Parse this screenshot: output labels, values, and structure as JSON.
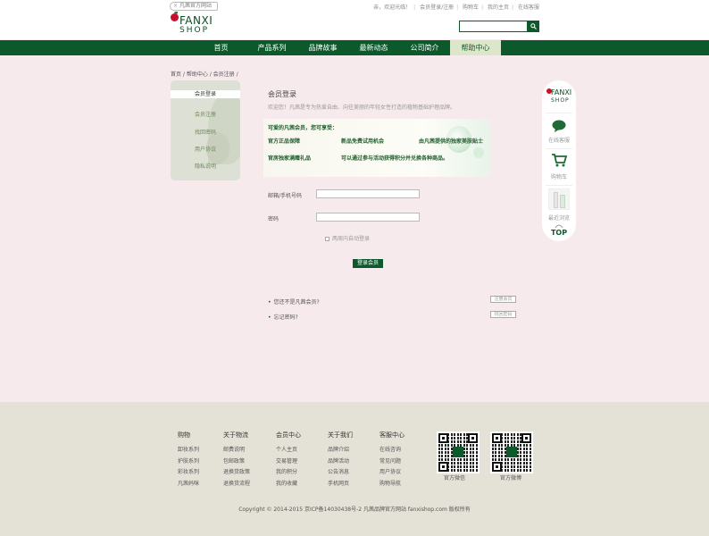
{
  "topbar": {
    "official_label": "凡茜官方网站",
    "links": [
      "亲，欢迎光临！",
      "会员登录/注册",
      "购物车",
      "我的主页",
      "在线客服"
    ]
  },
  "logo": {
    "line1": "FANXI",
    "line2": "SHOP"
  },
  "search": {
    "placeholder": ""
  },
  "nav": {
    "items": [
      "首页",
      "产品系列",
      "品牌故事",
      "最新动态",
      "公司简介",
      "帮助中心"
    ],
    "active_index": 5
  },
  "breadcrumb": "首页 / 帮助中心 / 会员注册 /",
  "sidebar": {
    "items": [
      "会员登录",
      "会员注册",
      "找回密码",
      "用户协议",
      "隐私说明"
    ],
    "active_index": 0
  },
  "login": {
    "title": "会员登录",
    "desc": "欢迎您！凡茜是专为热爱自由、向往美丽的年轻女性打造的植物基础护理品牌。",
    "promo": {
      "heading": "可爱的凡茜会员，您可享受：",
      "row1": [
        "官方正品保障",
        "新品免费试用机会",
        "由凡茜提供的独家美肤贴士"
      ],
      "row2": [
        "官房独家满赠礼品",
        "可以通过参与活动获得积分并兑换各种商品。"
      ]
    },
    "email_label": "邮箱/手机号码",
    "password_label": "密码",
    "remember_label": "两周内自动登录",
    "submit_label": "登录会员",
    "q1": "您还不是凡茜会员?",
    "q1_btn": "注册会员",
    "q2": "忘记密码?",
    "q2_btn": "找回密码"
  },
  "right_sidebar": {
    "logo1": "FANXI",
    "logo2": "SHOP",
    "service": "在线客服",
    "cart": "购物车",
    "recent": "最近浏览",
    "top": "TOP"
  },
  "footer": {
    "columns": [
      {
        "title": "购物",
        "items": [
          "卸妆系列",
          "护肤系列",
          "彩妆系列",
          "凡茜妈咪"
        ]
      },
      {
        "title": "关于物流",
        "items": [
          "邮费说明",
          "包邮政策",
          "退换货政策",
          "退换货流程"
        ]
      },
      {
        "title": "会员中心",
        "items": [
          "个人主页",
          "交易管理",
          "我的积分",
          "我的收藏"
        ]
      },
      {
        "title": "关于我们",
        "items": [
          "品牌介绍",
          "品牌活动",
          "公告消息",
          "手机网页"
        ]
      },
      {
        "title": "客服中心",
        "items": [
          "在线咨询",
          "常见问题",
          "用户协议",
          "购物导航"
        ]
      }
    ],
    "qr1_caption": "官方微信",
    "qr2_caption": "官方微博",
    "copyright": "Copyright © 2014-2015 京ICP备14030438号-2 凡茜品牌官方网站 fanxishop.com 版权所有"
  },
  "colors": {
    "brand_green": "#0c5a2b",
    "page_bg": "#f7eaec",
    "footer_bg": "#e4e1d7"
  }
}
